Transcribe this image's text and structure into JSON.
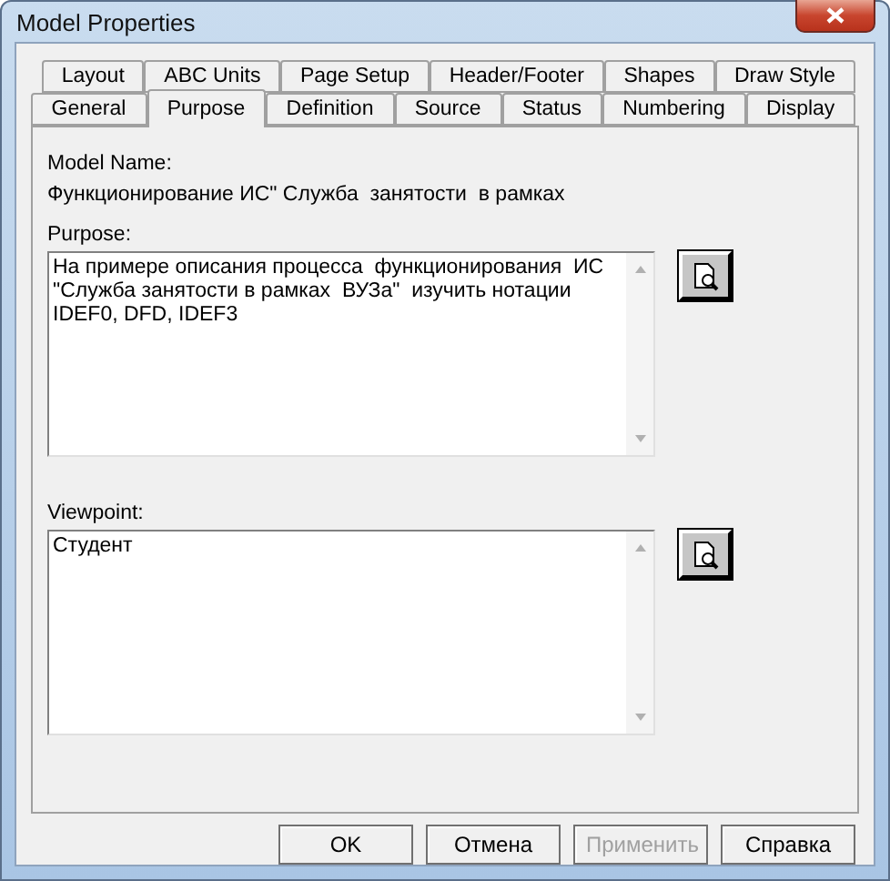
{
  "window": {
    "title": "Model Properties"
  },
  "tab_rows": [
    [
      {
        "label": "Layout",
        "selected": false
      },
      {
        "label": "ABC Units",
        "selected": false
      },
      {
        "label": "Page Setup",
        "selected": false
      },
      {
        "label": "Header/Footer",
        "selected": false
      },
      {
        "label": "Shapes",
        "selected": false
      },
      {
        "label": "Draw Style",
        "selected": false
      }
    ],
    [
      {
        "label": "General",
        "selected": false
      },
      {
        "label": "Purpose",
        "selected": true
      },
      {
        "label": "Definition",
        "selected": false
      },
      {
        "label": "Source",
        "selected": false
      },
      {
        "label": "Status",
        "selected": false
      },
      {
        "label": "Numbering",
        "selected": false
      },
      {
        "label": "Display",
        "selected": false
      }
    ]
  ],
  "model_name": {
    "label": "Model Name:",
    "value": "Функционирование ИС\" Служба  занятости  в рамках"
  },
  "purpose": {
    "label": "Purpose:",
    "value": "На примере описания процесса  функционирования  ИС\n\"Служба занятости в рамках  ВУЗа\"  изучить нотации\nIDEF0, DFD, IDEF3"
  },
  "viewpoint": {
    "label": "Viewpoint:",
    "value": "Студент"
  },
  "buttons": [
    {
      "label": "OK",
      "disabled": false
    },
    {
      "label": "Отмена",
      "disabled": false
    },
    {
      "label": "Применить",
      "disabled": true
    },
    {
      "label": "Справка",
      "disabled": false
    }
  ]
}
